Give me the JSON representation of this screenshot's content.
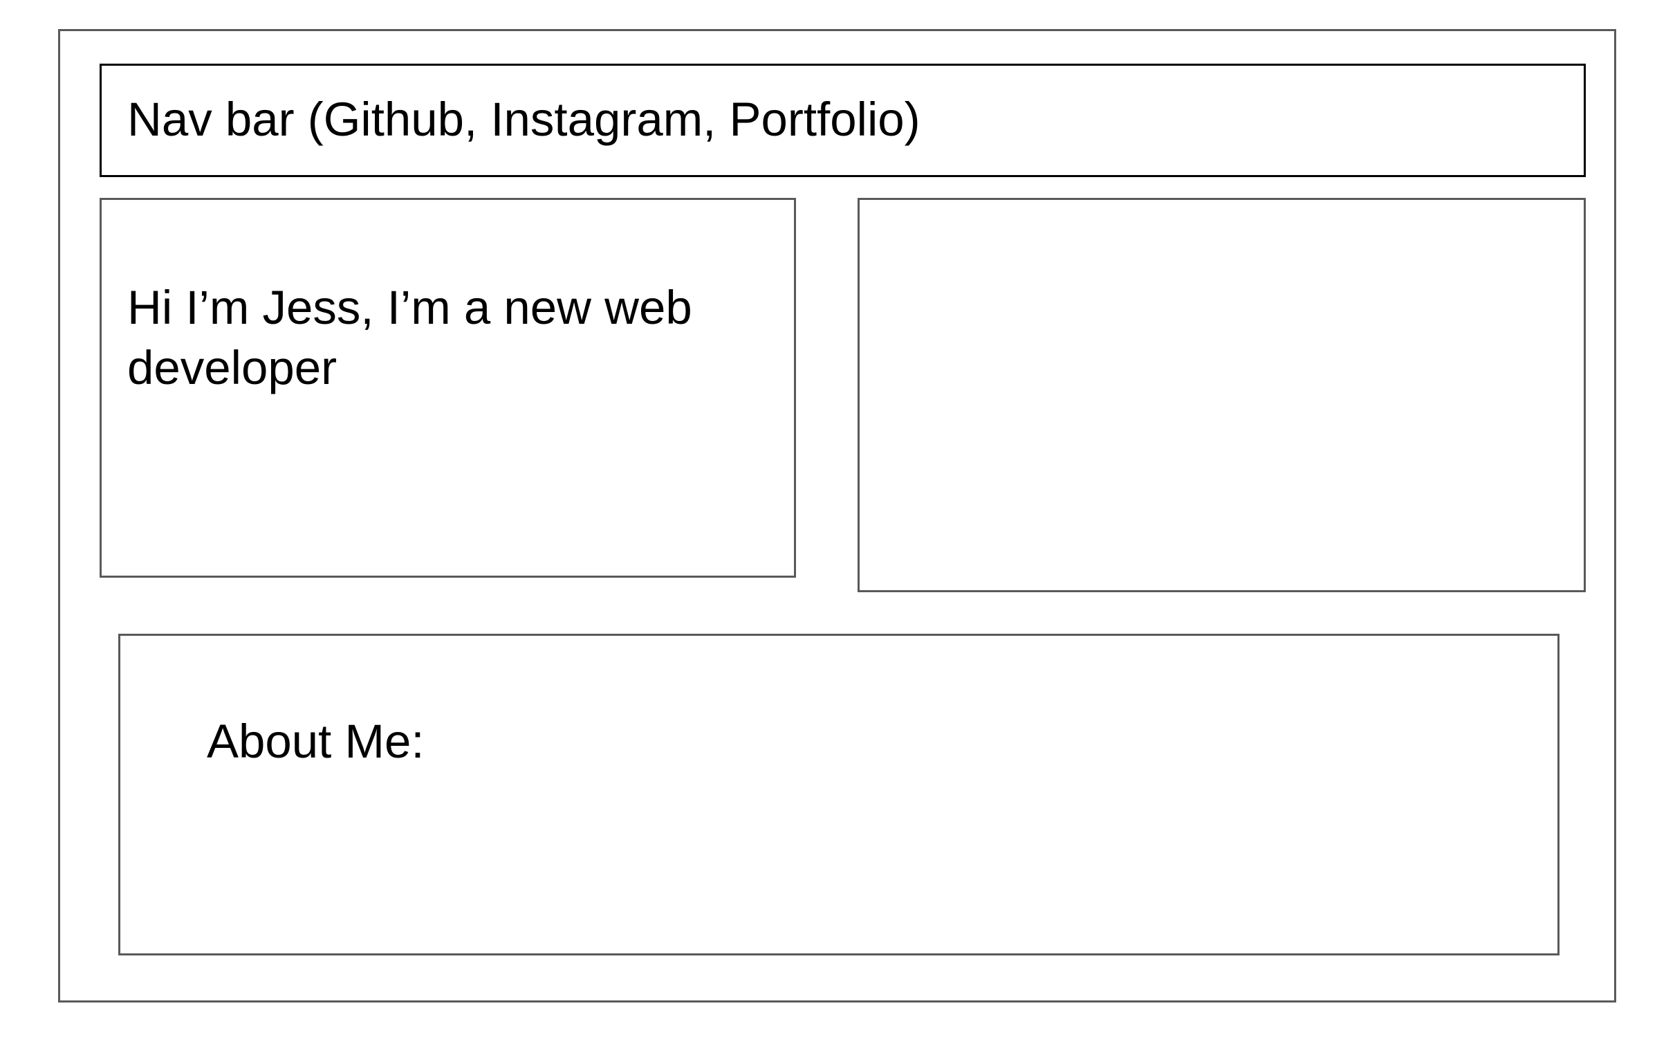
{
  "wireframe": {
    "nav_bar": {
      "label": "Nav bar (Github, Instagram, Portfolio)"
    },
    "intro": {
      "text": "Hi I’m Jess, I’m a new web developer"
    },
    "image_placeholder": {},
    "about": {
      "label": "About Me:"
    }
  },
  "colors": {
    "border": "#595959",
    "nav_border": "#000000",
    "text": "#000000",
    "background": "#ffffff"
  }
}
